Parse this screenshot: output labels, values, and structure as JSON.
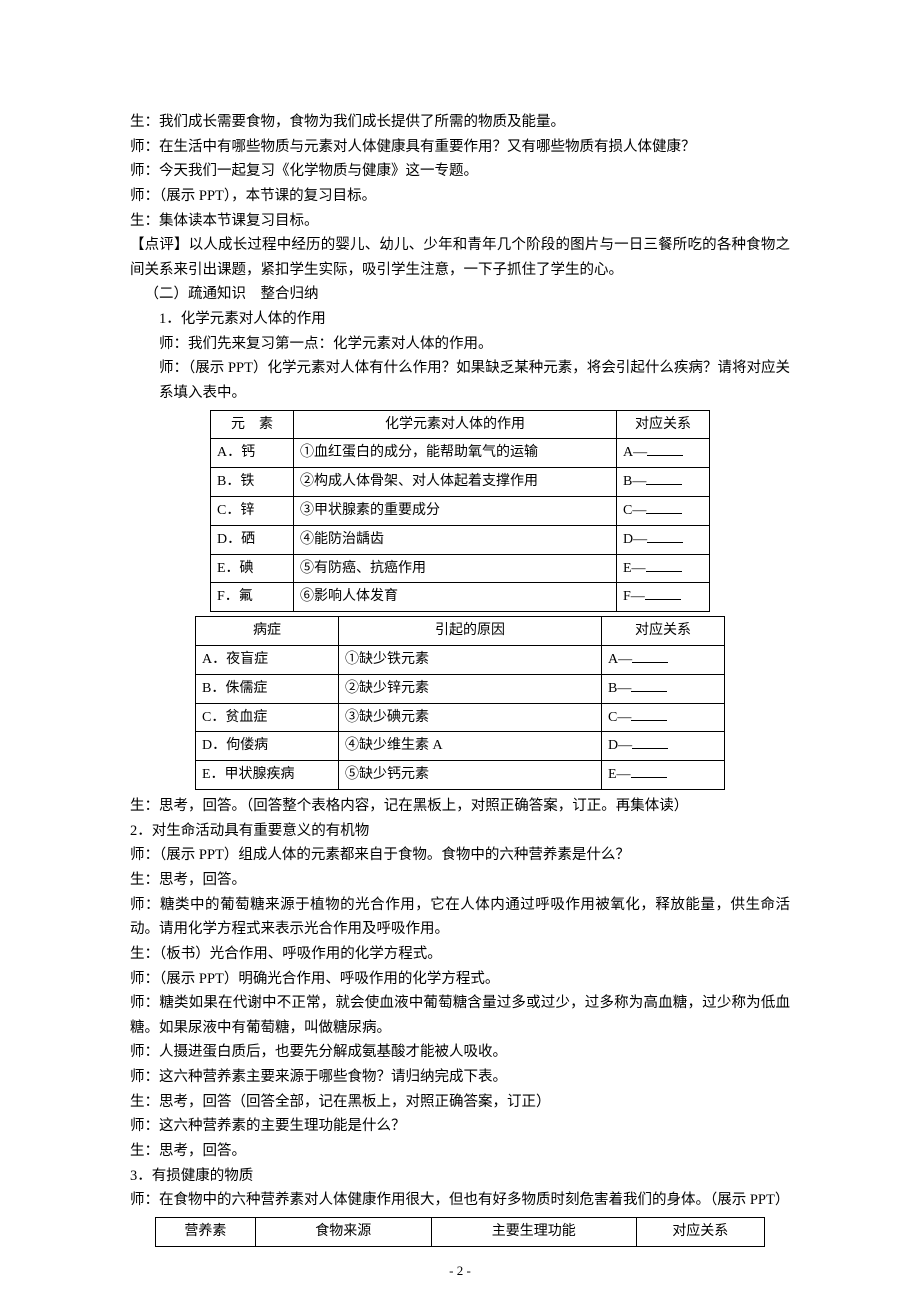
{
  "paras": {
    "p1": "生：我们成长需要食物，食物为我们成长提供了所需的物质及能量。",
    "p2": "师：在生活中有哪些物质与元素对人体健康具有重要作用？又有哪些物质有损人体健康？",
    "p3": "师：今天我们一起复习《化学物质与健康》这一专题。",
    "p4": "师：（展示 PPT），本节课的复习目标。",
    "p5": "生：集体读本节课复习目标。",
    "p6": "【点评】以人成长过程中经历的婴儿、幼儿、少年和青年几个阶段的图片与一日三餐所吃的各种食物之间关系来引出课题，紧扣学生实际，吸引学生注意，一下子抓住了学生的心。",
    "p7": "（二）疏通知识　整合归纳",
    "p8": "1．化学元素对人体的作用",
    "p9": "师：我们先来复习第一点：化学元素对人体的作用。",
    "p10": "师：（展示 PPT）化学元素对人体有什么作用？如果缺乏某种元素，将会引起什么疾病？请将对应关系填入表中。"
  },
  "table1": {
    "head": {
      "c1": "元　素",
      "c2": "化学元素对人体的作用",
      "c3": "对应关系"
    },
    "rows": [
      {
        "c1": "A．钙",
        "c2": "①血红蛋白的成分，能帮助氧气的运输",
        "c3": "A—"
      },
      {
        "c1": "B．铁",
        "c2": "②构成人体骨架、对人体起着支撑作用",
        "c3": "B—"
      },
      {
        "c1": "C．锌",
        "c2": "③甲状腺素的重要成分",
        "c3": "C—"
      },
      {
        "c1": "D．硒",
        "c2": "④能防治龋齿",
        "c3": "D—"
      },
      {
        "c1": "E．碘",
        "c2": "⑤有防癌、抗癌作用",
        "c3": "E—"
      },
      {
        "c1": "F．氟",
        "c2": "⑥影响人体发育",
        "c3": "F—"
      }
    ]
  },
  "table2": {
    "head": {
      "c1": "病症",
      "c2": "引起的原因",
      "c3": "对应关系"
    },
    "rows": [
      {
        "c1": "A．夜盲症",
        "c2": "①缺少铁元素",
        "c3": "A—"
      },
      {
        "c1": "B．侏儒症",
        "c2": "②缺少锌元素",
        "c3": "B—"
      },
      {
        "c1": "C．贫血症",
        "c2": "③缺少碘元素",
        "c3": "C—"
      },
      {
        "c1": "D．佝偻病",
        "c2": "④缺少维生素 A",
        "c3": "D—"
      },
      {
        "c1": "E．甲状腺疾病",
        "c2": "⑤缺少钙元素",
        "c3": "E—"
      }
    ]
  },
  "paras2": {
    "q1": "生：思考，回答。（回答整个表格内容，记在黑板上，对照正确答案，订正。再集体读）",
    "q2": "2．对生命活动具有重要意义的有机物",
    "q3": "师：（展示 PPT）组成人体的元素都来自于食物。食物中的六种营养素是什么？",
    "q4": "生：思考，回答。",
    "q5": "师：糖类中的葡萄糖来源于植物的光合作用，它在人体内通过呼吸作用被氧化，释放能量，供生命活动。请用化学方程式来表示光合作用及呼吸作用。",
    "q6": "生：（板书）光合作用、呼吸作用的化学方程式。",
    "q7": "师：（展示 PPT）明确光合作用、呼吸作用的化学方程式。",
    "q8": "师：糖类如果在代谢中不正常，就会使血液中葡萄糖含量过多或过少，过多称为高血糖，过少称为低血糖。如果尿液中有葡萄糖，叫做糖尿病。",
    "q9": "师：人摄进蛋白质后，也要先分解成氨基酸才能被人吸收。",
    "q10": "师：这六种营养素主要来源于哪些食物？请归纳完成下表。",
    "q11": "生：思考，回答（回答全部，记在黑板上，对照正确答案，订正）",
    "q12": "师：这六种营养素的主要生理功能是什么？",
    "q13": "生：思考，回答。",
    "q14": "3．有损健康的物质",
    "q15": "师：在食物中的六种营养素对人体健康作用很大，但也有好多物质时刻危害着我们的身体。（展示 PPT）"
  },
  "table3": {
    "h1": "营养素",
    "h2": "食物来源",
    "h3": "主要生理功能",
    "h4": "对应关系"
  },
  "pagenum": "- 2 -"
}
